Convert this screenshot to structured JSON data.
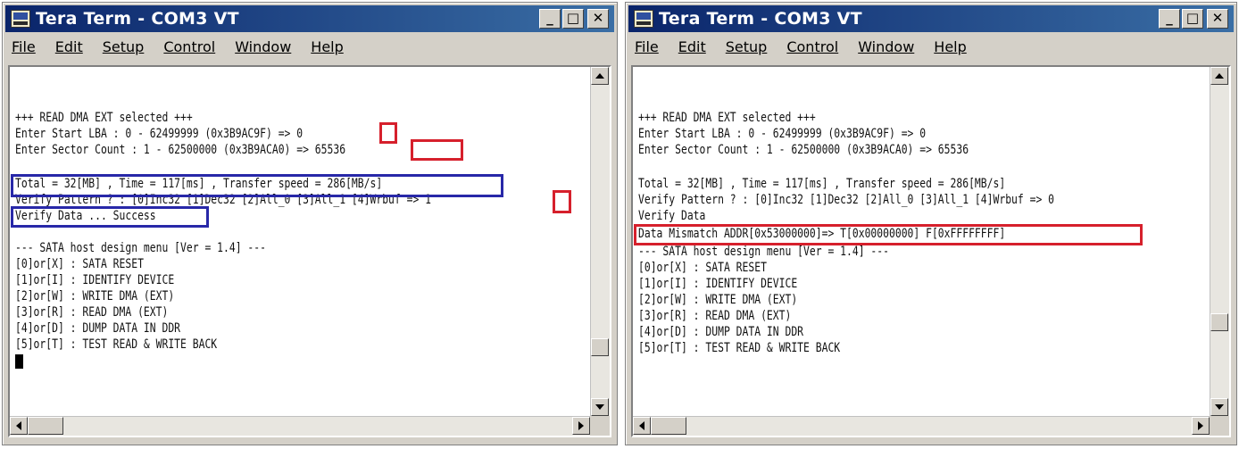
{
  "windows": [
    {
      "title": "Tera Term - COM3 VT",
      "menu": [
        "File",
        "Edit",
        "Setup",
        "Control",
        "Window",
        "Help"
      ],
      "lines": [
        "+++ READ DMA EXT selected +++",
        "Enter Start LBA : 0 - 62499999 (0x3B9AC9F) => 0",
        "Enter Sector Count : 1 - 62500000 (0x3B9ACA0) => 65536",
        "",
        "Total = 32[MB] , Time = 117[ms] , Transfer speed = 286[MB/s]",
        "Verify Pattern ? : [0]Inc32 [1]Dec32 [2]All_0 [3]All_1 [4]Wrbuf => 1",
        "Verify Data ... Success",
        "",
        "--- SATA host design menu [Ver = 1.4] ---",
        "[0]or[X] : SATA RESET",
        "[1]or[I] : IDENTIFY DEVICE",
        "[2]or[W] : WRITE DMA (EXT)",
        "[3]or[R] : READ DMA (EXT)",
        "[4]or[D] : DUMP DATA IN DDR",
        "[5]or[T] : TEST READ & WRITE BACK"
      ]
    },
    {
      "title": "Tera Term - COM3 VT",
      "menu": [
        "File",
        "Edit",
        "Setup",
        "Control",
        "Window",
        "Help"
      ],
      "lines": [
        "+++ READ DMA EXT selected +++",
        "Enter Start LBA : 0 - 62499999 (0x3B9AC9F) => 0",
        "Enter Sector Count : 1 - 62500000 (0x3B9ACA0) => 65536",
        "",
        "Total = 32[MB] , Time = 117[ms] , Transfer speed = 286[MB/s]",
        "Verify Pattern ? : [0]Inc32 [1]Dec32 [2]All_0 [3]All_1 [4]Wrbuf => 0",
        "Verify Data",
        "Data Mismatch ADDR[0x53000000]=> T[0x00000000] F[0xFFFFFFFF]",
        "--- SATA host design menu [Ver = 1.4] ---",
        "[0]or[X] : SATA RESET",
        "[1]or[I] : IDENTIFY DEVICE",
        "[2]or[W] : WRITE DMA (EXT)",
        "[3]or[R] : READ DMA (EXT)",
        "[4]or[D] : DUMP DATA IN DDR",
        "[5]or[T] : TEST READ & WRITE BACK"
      ]
    }
  ],
  "colors": {
    "highlight_red": "#d6202c",
    "highlight_blue": "#2828a8",
    "title_bar": "#0a246a"
  },
  "icons": {
    "app": "tera-term-icon",
    "minimize": "minimize-icon",
    "maximize": "maximize-icon",
    "close": "close-icon"
  }
}
